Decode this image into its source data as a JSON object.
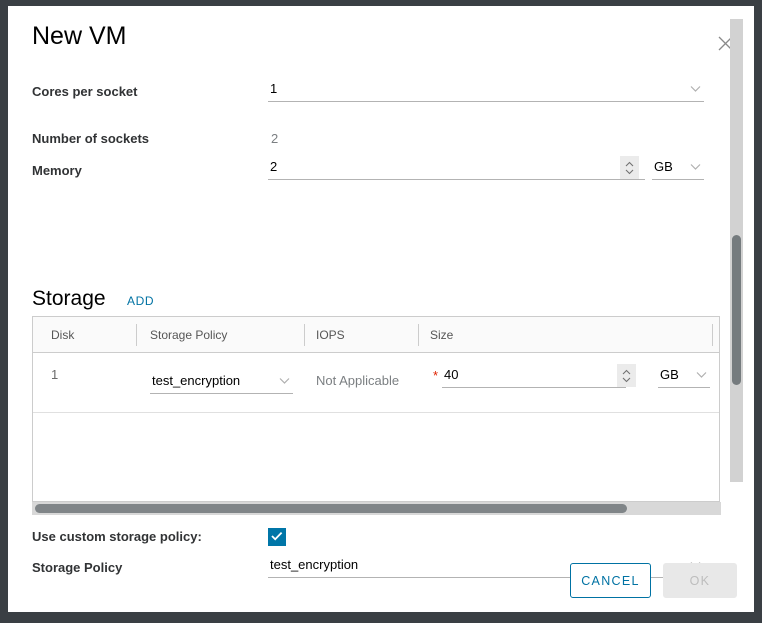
{
  "dialog": {
    "title": "New VM",
    "close_icon": "close-icon"
  },
  "form": {
    "cores_per_socket": {
      "label": "Cores per socket",
      "value": "1",
      "caret_icon": "chevron-down-icon"
    },
    "number_of_sockets": {
      "label": "Number of sockets",
      "value": "2"
    },
    "memory": {
      "label": "Memory",
      "value": "2",
      "unit": "GB",
      "spinner_icon": "spinner-updown-icon",
      "caret_icon": "chevron-down-icon"
    }
  },
  "storage": {
    "section_title": "Storage",
    "add_label": "ADD",
    "columns": [
      "Disk",
      "Storage Policy",
      "IOPS",
      "Size"
    ],
    "rows": [
      {
        "disk": "1",
        "storage_policy": "test_encryption",
        "iops": "Not Applicable",
        "size_required_marker": "*",
        "size": "40",
        "size_unit": "GB"
      }
    ],
    "hscrollbar": "horizontal-scrollbar"
  },
  "custom_policy": {
    "label": "Use custom storage policy:",
    "checked": true,
    "check_icon": "checkmark-icon"
  },
  "storage_policy": {
    "label": "Storage Policy",
    "value": "test_encryption",
    "caret_icon": "chevron-down-icon"
  },
  "footer": {
    "cancel_label": "CANCEL",
    "ok_label": "OK",
    "ok_disabled": true
  },
  "colors": {
    "accent": "#0072a3",
    "checkbox": "#0076a8",
    "required": "#e02200",
    "label_text": "#313335",
    "muted_text": "#7b7f82",
    "border": "#cccccc",
    "scroll_thumb": "#757b7e"
  }
}
